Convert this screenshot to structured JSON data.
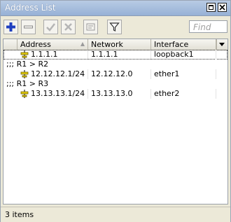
{
  "window": {
    "title": "Address List"
  },
  "toolbar": {
    "add_icon": "plus-icon",
    "remove_icon": "minus-icon",
    "enable_icon": "check-icon",
    "disable_icon": "x-icon",
    "comment_icon": "note-icon",
    "filter_icon": "filter-icon",
    "find_placeholder": "Find"
  },
  "table": {
    "columns": [
      "Address",
      "Network",
      "Interface"
    ],
    "rows": [
      {
        "type": "entry",
        "address": "1.1.1.1",
        "network": "1.1.1.1",
        "interface": "loopback1",
        "selected": true
      },
      {
        "type": "comment",
        "text": ";;; R1 > R2"
      },
      {
        "type": "entry",
        "address": "12.12.12.1/24",
        "network": "12.12.12.0",
        "interface": "ether1",
        "selected": false
      },
      {
        "type": "comment",
        "text": ";;; R1 > R3"
      },
      {
        "type": "entry",
        "address": "13.13.13.1/24",
        "network": "13.13.13.0",
        "interface": "ether2",
        "selected": false
      }
    ]
  },
  "status": {
    "count_text": "3 items"
  },
  "colors": {
    "add_blue": "#1f3fbf",
    "address_icon": "#e8d000",
    "title_gradient_top": "#b8cbe4",
    "title_gradient_bottom": "#97b1d6"
  }
}
